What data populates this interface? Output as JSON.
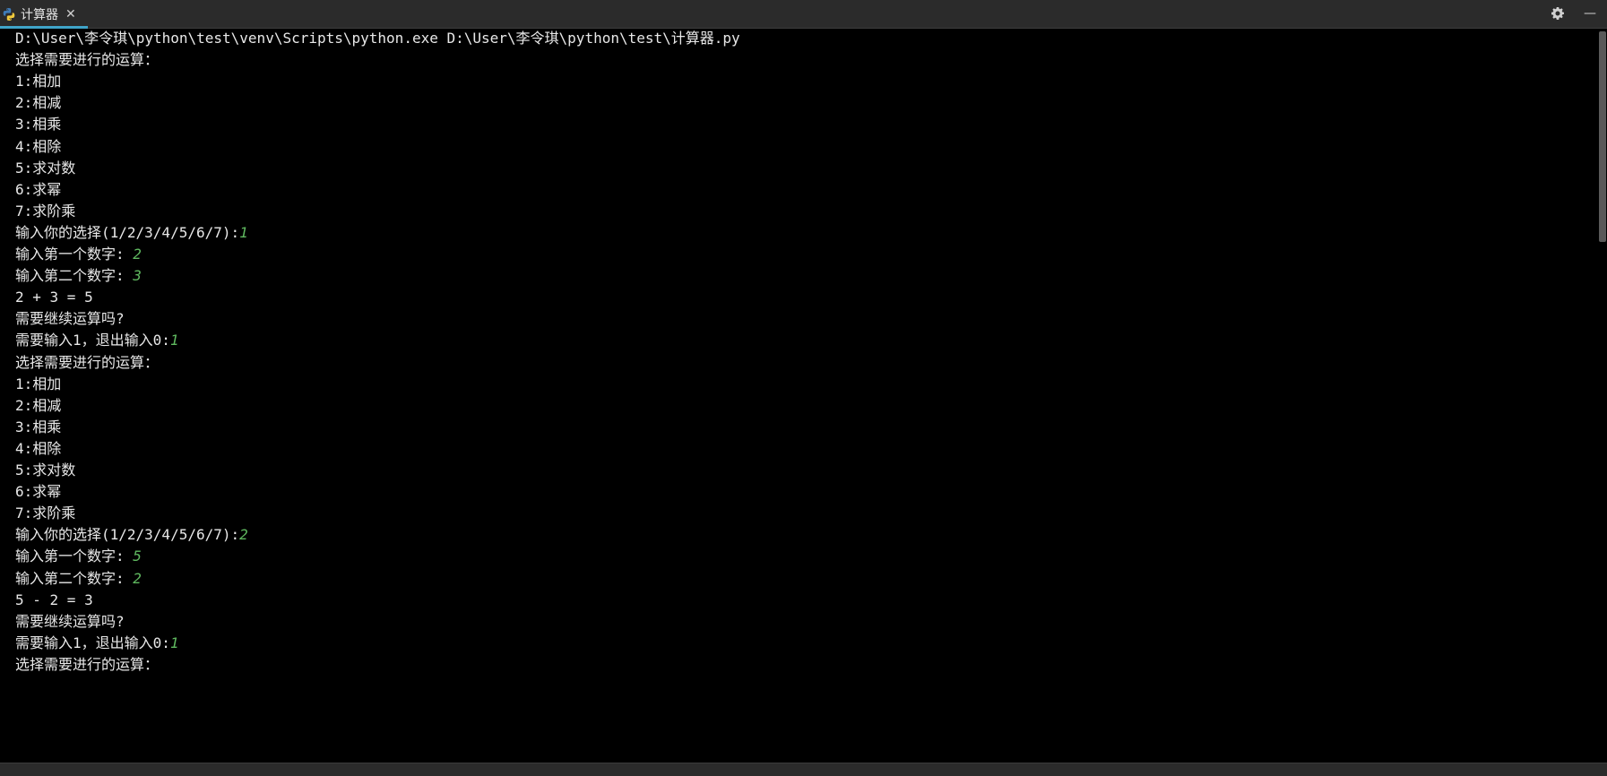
{
  "tab": {
    "title": "计算器",
    "icon": "python-icon",
    "close_glyph": "✕"
  },
  "toolbar": {
    "settings_icon": "gear-icon",
    "minimize_glyph": "—"
  },
  "console": {
    "lines": [
      {
        "text": "D:\\User\\李令琪\\python\\test\\venv\\Scripts\\python.exe D:\\User\\李令琪\\python\\test\\计算器.py",
        "input": ""
      },
      {
        "text": "选择需要进行的运算：",
        "input": ""
      },
      {
        "text": "1:相加",
        "input": ""
      },
      {
        "text": "2:相减",
        "input": ""
      },
      {
        "text": "3:相乘",
        "input": ""
      },
      {
        "text": "4:相除",
        "input": ""
      },
      {
        "text": "5:求对数",
        "input": ""
      },
      {
        "text": "6:求幂",
        "input": ""
      },
      {
        "text": "7:求阶乘",
        "input": ""
      },
      {
        "text": "输入你的选择(1/2/3/4/5/6/7):",
        "input": "1"
      },
      {
        "text": "输入第一个数字: ",
        "input": "2"
      },
      {
        "text": "输入第二个数字: ",
        "input": "3"
      },
      {
        "text": "2 + 3 = 5",
        "input": ""
      },
      {
        "text": "需要继续运算吗?",
        "input": ""
      },
      {
        "text": "需要输入1，退出输入0:",
        "input": "1"
      },
      {
        "text": "选择需要进行的运算：",
        "input": ""
      },
      {
        "text": "1:相加",
        "input": ""
      },
      {
        "text": "2:相减",
        "input": ""
      },
      {
        "text": "3:相乘",
        "input": ""
      },
      {
        "text": "4:相除",
        "input": ""
      },
      {
        "text": "5:求对数",
        "input": ""
      },
      {
        "text": "6:求幂",
        "input": ""
      },
      {
        "text": "7:求阶乘",
        "input": ""
      },
      {
        "text": "输入你的选择(1/2/3/4/5/6/7):",
        "input": "2"
      },
      {
        "text": "输入第一个数字: ",
        "input": "5"
      },
      {
        "text": "输入第二个数字: ",
        "input": "2"
      },
      {
        "text": "5 - 2 = 3",
        "input": ""
      },
      {
        "text": "需要继续运算吗?",
        "input": ""
      },
      {
        "text": "需要输入1，退出输入0:",
        "input": "1"
      },
      {
        "text": "选择需要进行的运算：",
        "input": ""
      }
    ]
  },
  "colors": {
    "background": "#000000",
    "text": "#e8e8e8",
    "user_input": "#5fb85f",
    "tab_accent": "#3fa4c9"
  }
}
